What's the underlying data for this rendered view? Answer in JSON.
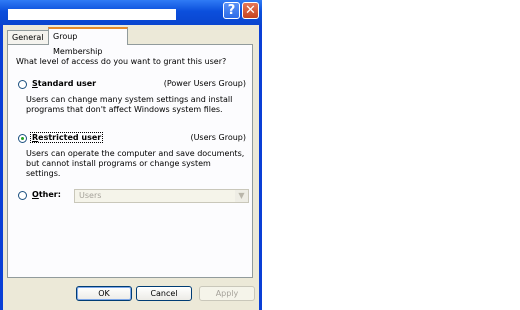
{
  "tabs": [
    {
      "label": "General",
      "active": false
    },
    {
      "label": "Group Membership",
      "active": true
    }
  ],
  "question": "What level of access do you want to grant this user?",
  "options": [
    {
      "label_hotkey": "S",
      "label_rest": "tandard user",
      "group": "(Power Users Group)",
      "description": "Users can change many system settings and install programs that don't affect Windows system files.",
      "selected": false
    },
    {
      "label_hotkey": "R",
      "label_rest": "estricted user",
      "group": "(Users Group)",
      "description": "Users can operate the computer and save documents, but cannot install programs or change system settings.",
      "selected": true
    },
    {
      "label_hotkey": "O",
      "label_rest": "ther:",
      "selected": false
    }
  ],
  "other_select": {
    "value": "Users",
    "enabled": false
  },
  "buttons": {
    "ok": "OK",
    "cancel": "Cancel",
    "apply": "Apply"
  },
  "titlebar": {
    "help_glyph": "?",
    "close_glyph": "✕"
  },
  "colors": {
    "titlebar": "#0b4fdc",
    "dialog_bg": "#ece9d8",
    "radio_dot": "#21a121"
  }
}
